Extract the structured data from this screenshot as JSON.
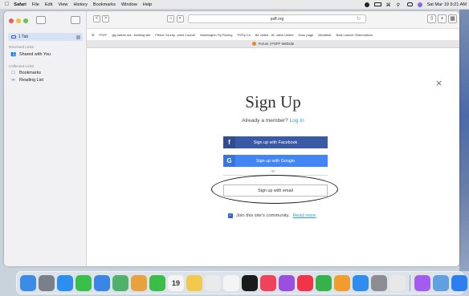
{
  "menubar": {
    "app": "Safari",
    "items": [
      "File",
      "Edit",
      "View",
      "History",
      "Bookmarks",
      "Window",
      "Help"
    ],
    "clock": "Sat Mar 19  9:21 AM"
  },
  "sidebar": {
    "tab_label": "1 Tab",
    "received_heading": "Received Links",
    "shared_label": "Shared with You",
    "collected_heading": "Collected Links",
    "bookmarks_label": "Bookmarks",
    "reading_list_label": "Reading List"
  },
  "toolbar": {
    "back": "<",
    "forward": ">",
    "url": "psff.org",
    "reload": "↻"
  },
  "favorites": [
    "PSFF",
    "gig harbor ma...building site",
    "Pierce County...shed Council",
    "Washington Fly Fishing",
    "PSFly Co",
    "Be united - W...aters United",
    "Koso page",
    "Woodfest",
    "Boat Launch Observations"
  ],
  "tab_title": "Forum | PSFF Website",
  "signup": {
    "close": "×",
    "title": "Sign Up",
    "member_text": "Already a member?",
    "login_link": "Log In",
    "facebook": "Sign up with Facebook",
    "google": "Sign up with Google",
    "or": "or",
    "email": "Sign up with email",
    "join_text": "Join this site's community.",
    "read_more": "Read more"
  },
  "dock": {
    "calendar_day": "19",
    "apps": [
      {
        "name": "finder-icon",
        "color": "#3d8be8"
      },
      {
        "name": "launchpad-icon",
        "color": "#7a7f8a"
      },
      {
        "name": "safari-icon",
        "color": "#2c8ef0"
      },
      {
        "name": "messages-icon",
        "color": "#38c04a"
      },
      {
        "name": "mail-icon",
        "color": "#3a86e6"
      },
      {
        "name": "maps-icon",
        "color": "#4fb26a"
      },
      {
        "name": "photos-icon",
        "color": "#e9a13b"
      },
      {
        "name": "facetime-icon",
        "color": "#3bbd4a"
      },
      {
        "name": "calendar-icon",
        "color": "#f4f4f4"
      },
      {
        "name": "notes-icon",
        "color": "#f2c94c"
      },
      {
        "name": "reminders-icon",
        "color": "#eaeaea"
      },
      {
        "name": "freeform-icon",
        "color": "#f4f4f4"
      },
      {
        "name": "tv-icon",
        "color": "#1a1a1a"
      },
      {
        "name": "music-icon",
        "color": "#f0435a"
      },
      {
        "name": "podcasts-icon",
        "color": "#9b4fe0"
      },
      {
        "name": "news-icon",
        "color": "#f2344a"
      },
      {
        "name": "numbers-icon",
        "color": "#35b24a"
      },
      {
        "name": "pages-icon",
        "color": "#f39c2e"
      },
      {
        "name": "appstore-icon",
        "color": "#2f8cf0"
      },
      {
        "name": "settings-icon",
        "color": "#8c8c92"
      },
      {
        "name": "chrome-icon",
        "color": "#e8e8e8"
      },
      {
        "name": "messenger-icon",
        "color": "#a45cf0"
      },
      {
        "name": "preview-icon",
        "color": "#5fa0e0"
      },
      {
        "name": "zoom-icon",
        "color": "#2d7ff0"
      }
    ]
  }
}
